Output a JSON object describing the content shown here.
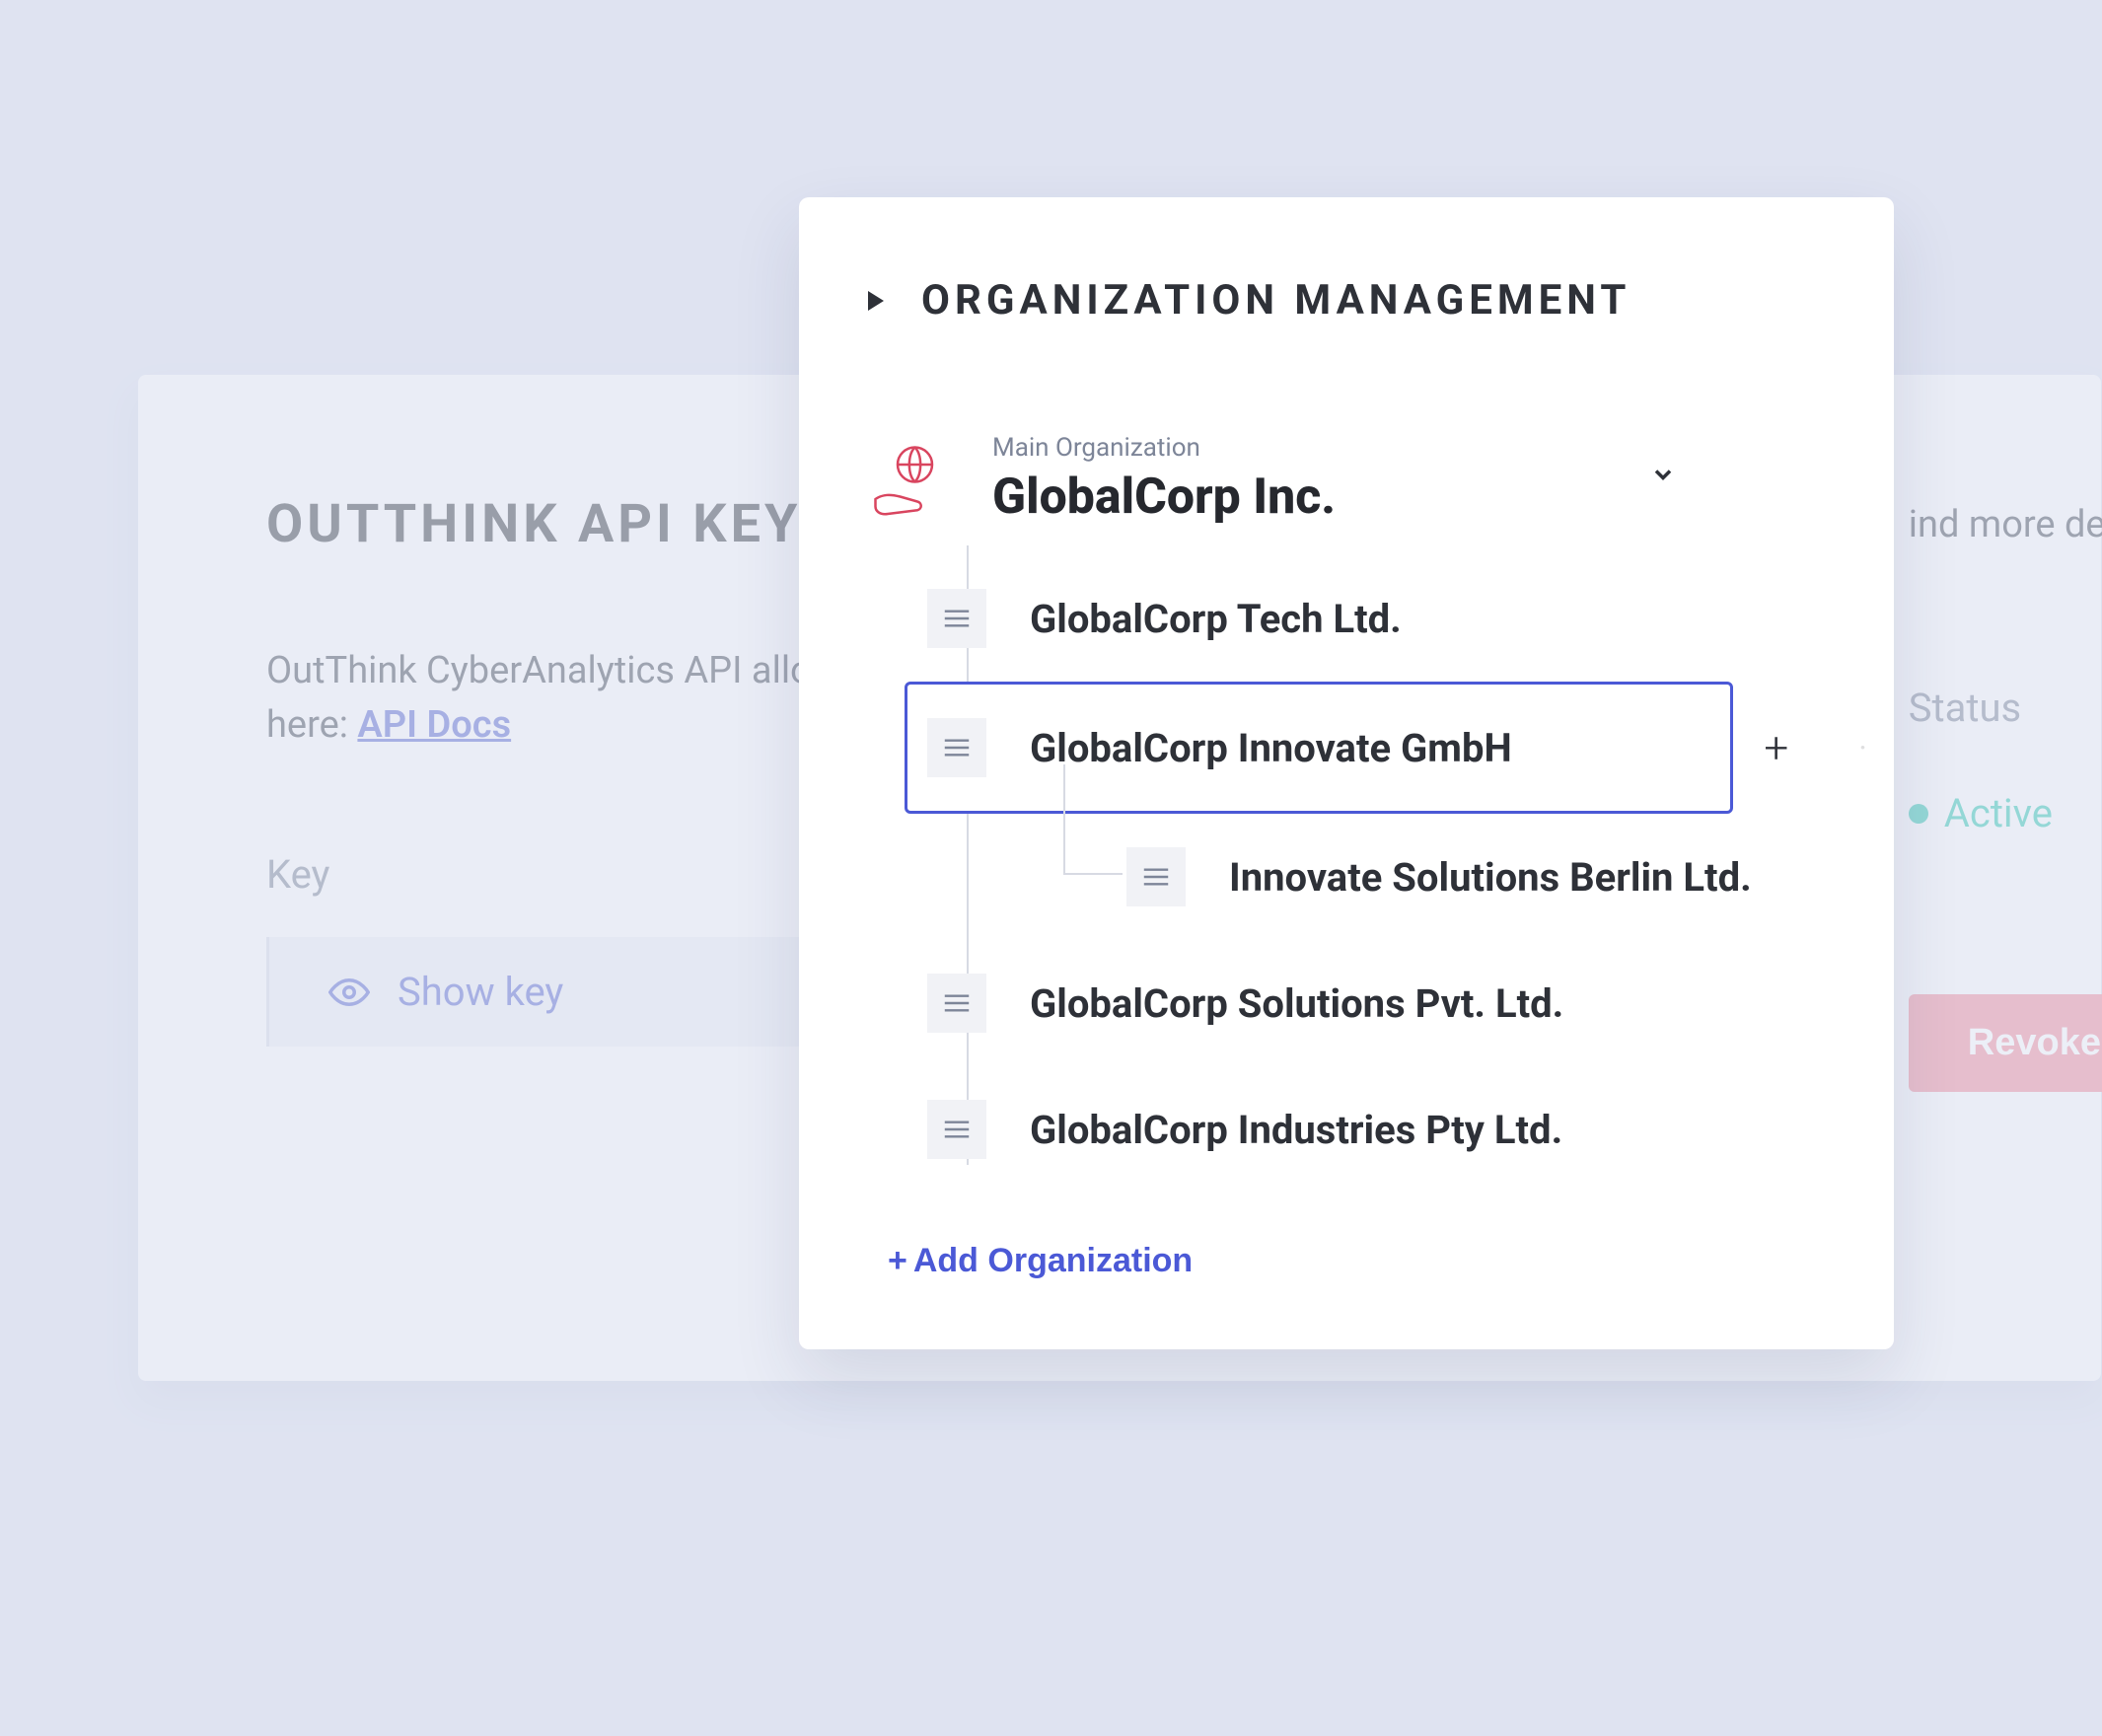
{
  "api_panel": {
    "title": "OUTTHINK API KEY",
    "desc_prefix": "OutThink CyberAnalytics API allow",
    "desc_line2_prefix": "here:  ",
    "docs_link": "API Docs",
    "find_more": "ind more det",
    "key_label": "Key",
    "show_key": "Show key",
    "status_label": "Status",
    "status_value": "Active",
    "revoke": "Revoke"
  },
  "org_panel": {
    "heading": "ORGANIZATION MANAGEMENT",
    "main_label": "Main Organization",
    "main_name": "GlobalCorp Inc.",
    "add_label": "Add Organization",
    "nodes": [
      {
        "name": "GlobalCorp Tech Ltd."
      },
      {
        "name": "GlobalCorp Innovate GmbH",
        "selected": true,
        "children": [
          {
            "name": "Innovate Solutions Berlin Ltd."
          }
        ]
      },
      {
        "name": "GlobalCorp Solutions Pvt. Ltd."
      },
      {
        "name": "GlobalCorp Industries Pty Ltd."
      }
    ]
  }
}
